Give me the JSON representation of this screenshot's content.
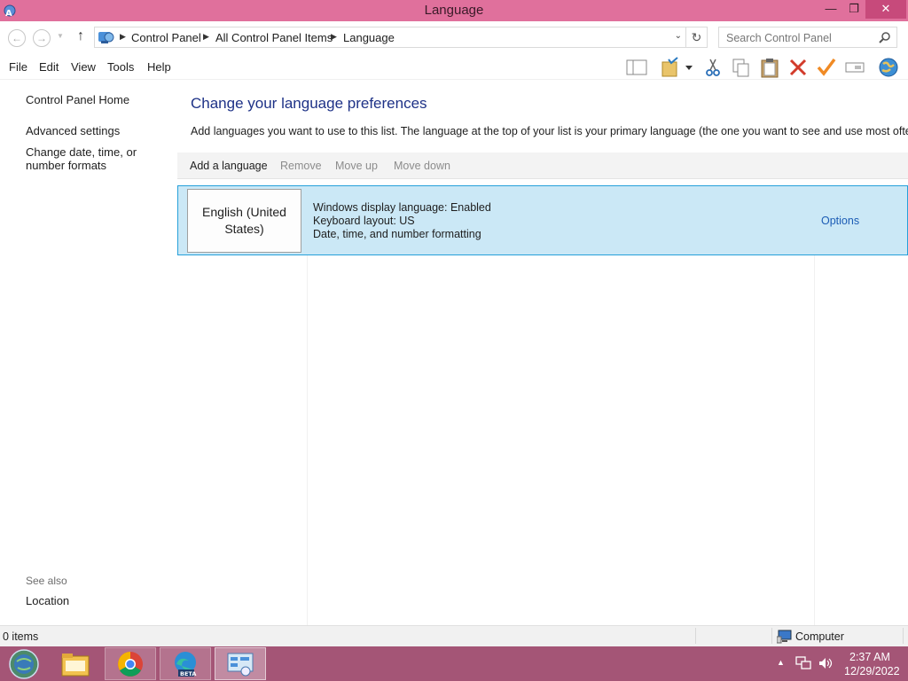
{
  "window": {
    "title": "Language",
    "controls": {
      "minimize": "—",
      "maximize": "❐",
      "close": "✕"
    }
  },
  "address": {
    "crumbs": [
      "Control Panel",
      "All Control Panel Items",
      "Language"
    ],
    "search_placeholder": "Search Control Panel"
  },
  "menu": [
    "File",
    "Edit",
    "View",
    "Tools",
    "Help"
  ],
  "toolbar_icons": [
    "layout-icon",
    "properties-icon",
    "dropdown-arrow-icon",
    "cut-icon",
    "copy-icon",
    "paste-icon",
    "delete-icon",
    "check-icon",
    "rename-icon",
    "globe-icon"
  ],
  "left_pane": {
    "links": [
      "Control Panel Home",
      "Advanced settings",
      "Change date, time, or number formats"
    ],
    "see_also_label": "See also",
    "see_also_links": [
      "Location"
    ]
  },
  "main": {
    "title": "Change your language preferences",
    "description": "Add languages you want to use to this list. The language at the top of your list is your primary language (the one you want to see and use most often).",
    "commands": {
      "add": "Add a language",
      "remove": "Remove",
      "move_up": "Move up",
      "move_down": "Move down"
    },
    "languages": [
      {
        "name": "English (United States)",
        "details": [
          "Windows display language: Enabled",
          "Keyboard layout: US",
          "Date, time, and number formatting"
        ],
        "options_label": "Options"
      }
    ]
  },
  "status": {
    "items": "0 items",
    "location": "Computer"
  },
  "taskbar": {
    "apps": [
      "start-orb",
      "file-explorer",
      "chrome",
      "edge-beta",
      "control-panel"
    ],
    "clock_time": "2:37 AM",
    "clock_date": "12/29/2022"
  },
  "colors": {
    "titlebar": "#e0709c",
    "taskbar": "#a45576",
    "selection": "#cbe8f6",
    "selection_border": "#26a0da",
    "heading": "#1e3287",
    "link": "#1c5cb5"
  }
}
